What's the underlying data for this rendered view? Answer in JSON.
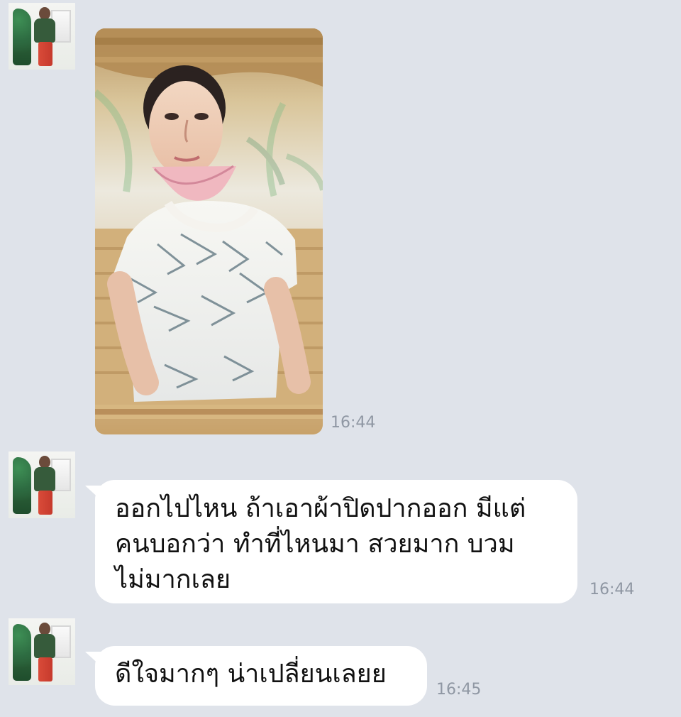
{
  "chat": {
    "messages": [
      {
        "type": "image",
        "time": "16:44"
      },
      {
        "type": "text",
        "lines": [
          "ออกไปไหน ถ้าเอาผ้าปิดปากออก มีแต่",
          "คนบอกว่า ทำที่ไหนมา สวยมาก บวม",
          "ไม่มากเลย"
        ],
        "time": "16:44"
      },
      {
        "type": "text",
        "lines": [
          "ดีใจมากๆ น่าเปลี่ยนเลยย"
        ],
        "time": "16:45"
      }
    ]
  }
}
